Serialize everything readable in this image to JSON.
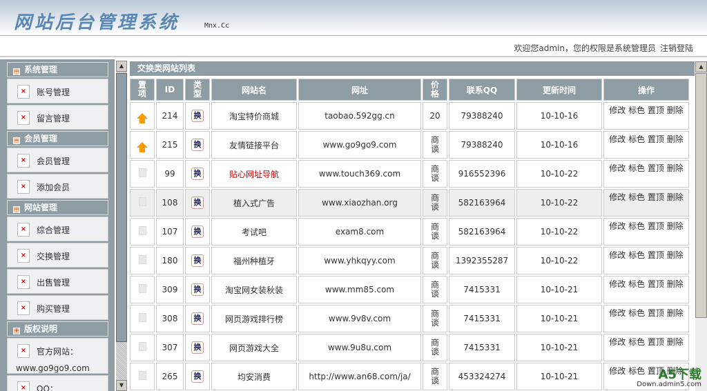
{
  "header": {
    "logo": "网站后台管理系统",
    "logo_sub": "Mnx.Cc"
  },
  "topbar": {
    "welcome": "欢迎您admin，您的权限是系统管理员",
    "logout": "注销登陆"
  },
  "sidebar": [
    {
      "title": "系统管理",
      "icon": "minus",
      "items": [
        "账号管理",
        "留言管理"
      ]
    },
    {
      "title": "会员管理",
      "icon": "minus",
      "items": [
        "会员管理",
        "添加会员"
      ]
    },
    {
      "title": "网站管理",
      "icon": "minus",
      "items": [
        "综合管理",
        "交换管理",
        "出售管理",
        "购买管理"
      ]
    },
    {
      "title": "版权说明",
      "icon": "plus",
      "items": [
        "官方网站：",
        "QQ："
      ],
      "sub": "www.go9go9.com"
    }
  ],
  "main": {
    "title": "交换类网站列表",
    "columns": [
      "置项",
      "ID",
      "类型",
      "网站名",
      "网址",
      "价格",
      "联系QQ",
      "更新时间",
      "操作"
    ],
    "type_label": "换",
    "ops": "修改 标色 置顶 删除",
    "rows": [
      {
        "top": true,
        "id": "214",
        "name": "淘宝特价商城",
        "url": "taobao.592gg.cn",
        "price": "20",
        "qq": "79388240",
        "time": "10-10-16"
      },
      {
        "top": true,
        "id": "215",
        "name": "友情链接平台",
        "url": "www.go9go9.com",
        "price": "商谈",
        "qq": "79388240",
        "time": "10-10-16"
      },
      {
        "top": false,
        "id": "99",
        "name": "贴心网址导航",
        "url": "www.touch369.com",
        "price": "商谈",
        "qq": "916552396",
        "time": "10-10-22",
        "red": true
      },
      {
        "top": false,
        "id": "108",
        "name": "植入式广告",
        "url": "www.xiaozhan.org",
        "price": "商谈",
        "qq": "582163964",
        "time": "10-10-22",
        "hl": true
      },
      {
        "top": false,
        "id": "107",
        "name": "考试吧",
        "url": "exam8.com",
        "price": "商谈",
        "qq": "582163964",
        "time": "10-10-22"
      },
      {
        "top": false,
        "id": "180",
        "name": "福州种植牙",
        "url": "www.yhkqyy.com",
        "price": "商谈",
        "qq": "1392355287",
        "time": "10-10-22"
      },
      {
        "top": false,
        "id": "309",
        "name": "淘宝网女装秋装",
        "url": "www.mm85.com",
        "price": "商谈",
        "qq": "7415331",
        "time": "10-10-21"
      },
      {
        "top": false,
        "id": "308",
        "name": "网页游戏排行榜",
        "url": "www.9v8v.com",
        "price": "商谈",
        "qq": "7415331",
        "time": "10-10-21"
      },
      {
        "top": false,
        "id": "307",
        "name": "网页游戏大全",
        "url": "www.9u8u.com",
        "price": "商谈",
        "qq": "7415331",
        "time": "10-10-21"
      },
      {
        "top": false,
        "id": "265",
        "name": "均安消费",
        "url": "http://www.an68.com/ja/",
        "price": "商谈",
        "qq": "453324274",
        "time": "10-10-21"
      }
    ]
  },
  "watermark": {
    "brand": "A5下载",
    "site": "Down.admin5.com"
  }
}
